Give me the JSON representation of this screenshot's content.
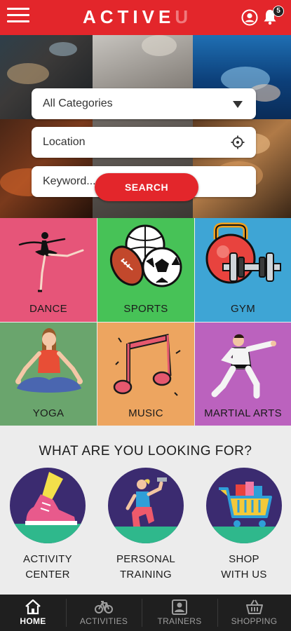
{
  "header": {
    "logo_main": "ACTIVE",
    "logo_accent": "U",
    "notification_count": "5",
    "bg_color": "#e3262b"
  },
  "search": {
    "category_value": "All Categories",
    "location_placeholder": "Location",
    "keyword_placeholder": "Keyword...",
    "button_label": "SEARCH"
  },
  "categories": [
    {
      "label": "DANCE",
      "color": "#e65579",
      "icon": "ballerina-icon"
    },
    {
      "label": "SPORTS",
      "color": "#47c257",
      "icon": "sports-balls-icon"
    },
    {
      "label": "GYM",
      "color": "#3ea5d5",
      "icon": "kettlebell-dumbbell-icon"
    },
    {
      "label": "YOGA",
      "color": "#6aa56d",
      "icon": "yoga-pose-icon"
    },
    {
      "label": "MUSIC",
      "color": "#eda560",
      "icon": "music-note-icon"
    },
    {
      "label": "MARTIAL ARTS",
      "color": "#bb62be",
      "icon": "karate-icon"
    }
  ],
  "looking": {
    "title": "WHAT ARE YOU LOOKING FOR?",
    "options": [
      {
        "line1": "ACTIVITY",
        "line2": "CENTER",
        "icon": "running-shoe-icon"
      },
      {
        "line1": "PERSONAL",
        "line2": "TRAINING",
        "icon": "trainer-icon"
      },
      {
        "line1": "SHOP",
        "line2": "WITH US",
        "icon": "shopping-cart-icon"
      }
    ]
  },
  "nav": [
    {
      "label": "HOME",
      "icon": "home-icon",
      "active": true
    },
    {
      "label": "ACTIVITIES",
      "icon": "bicycle-icon",
      "active": false
    },
    {
      "label": "TRAINERS",
      "icon": "trainer-id-icon",
      "active": false
    },
    {
      "label": "SHOPPING",
      "icon": "basket-icon",
      "active": false
    }
  ]
}
